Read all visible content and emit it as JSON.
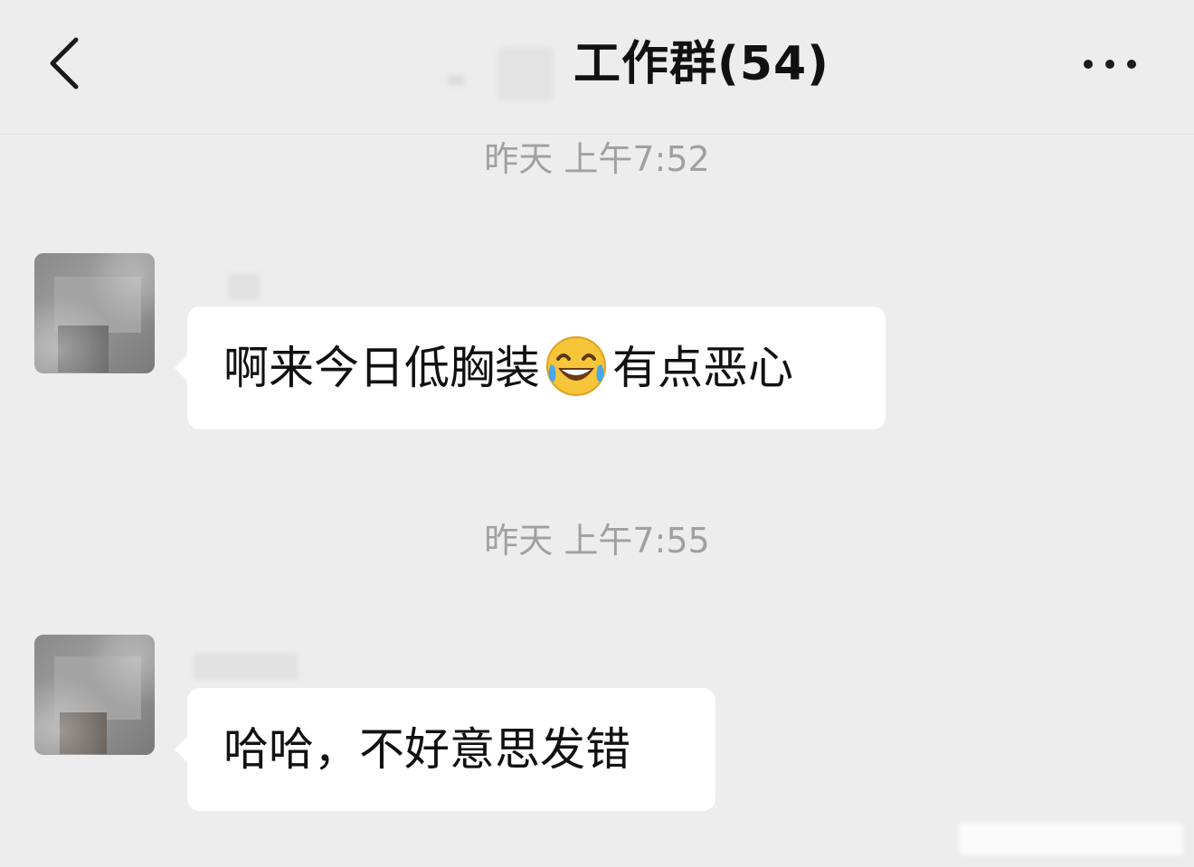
{
  "header": {
    "title": "工作群(54)",
    "back_icon": "chevron-left-icon",
    "more_icon": "more-horizontal-icon"
  },
  "messages": [
    {
      "timestamp": "昨天 上午7:52",
      "text_before_emoji": "啊来今日低胸装",
      "emoji": "face-with-tears-of-joy",
      "text_after_emoji": "有点恶心"
    },
    {
      "timestamp": "昨天 上午7:55",
      "text": "哈哈，不好意思发错"
    }
  ],
  "colors": {
    "background": "#ededed",
    "bubble": "#ffffff",
    "timestamp": "#a0a0a0",
    "title": "#111111"
  }
}
